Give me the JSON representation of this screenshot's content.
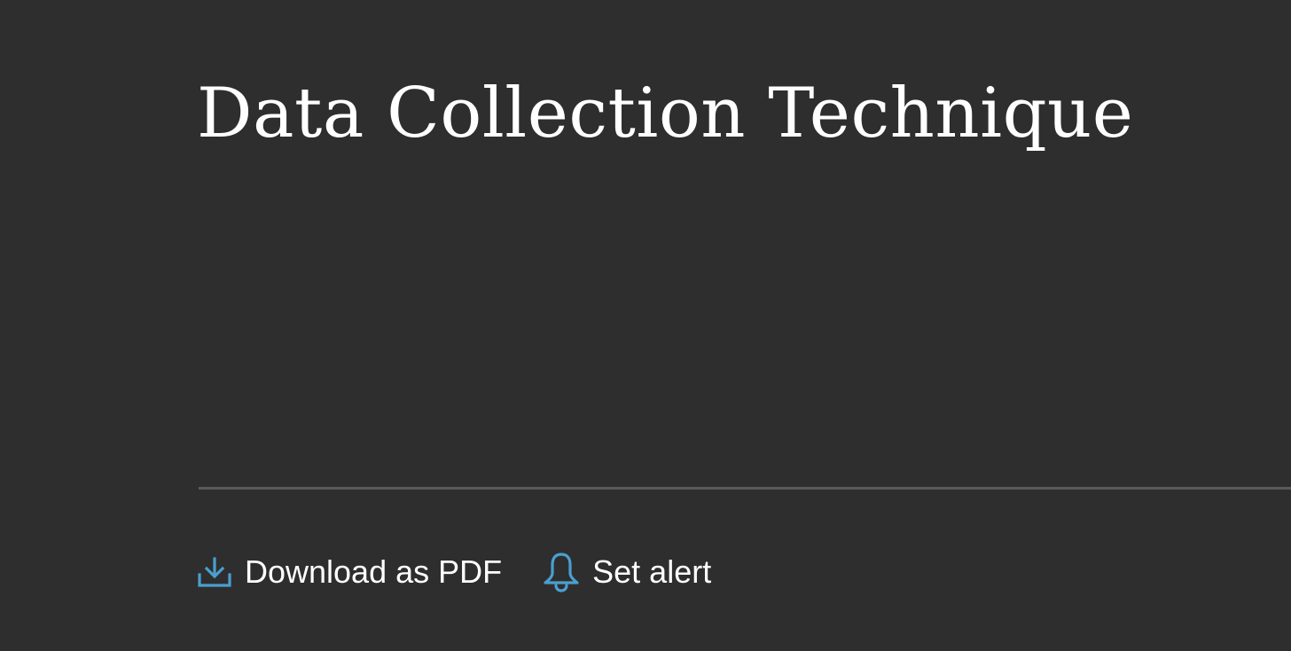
{
  "page": {
    "title": "Data Collection Technique"
  },
  "actions": {
    "download": {
      "label": "Download as PDF",
      "icon": "download-icon"
    },
    "alert": {
      "label": "Set alert",
      "icon": "bell-icon"
    }
  },
  "colors": {
    "background": "#2e2e2e",
    "text": "#ffffff",
    "accent": "#4a9fd0",
    "divider": "#5a5a5a"
  }
}
